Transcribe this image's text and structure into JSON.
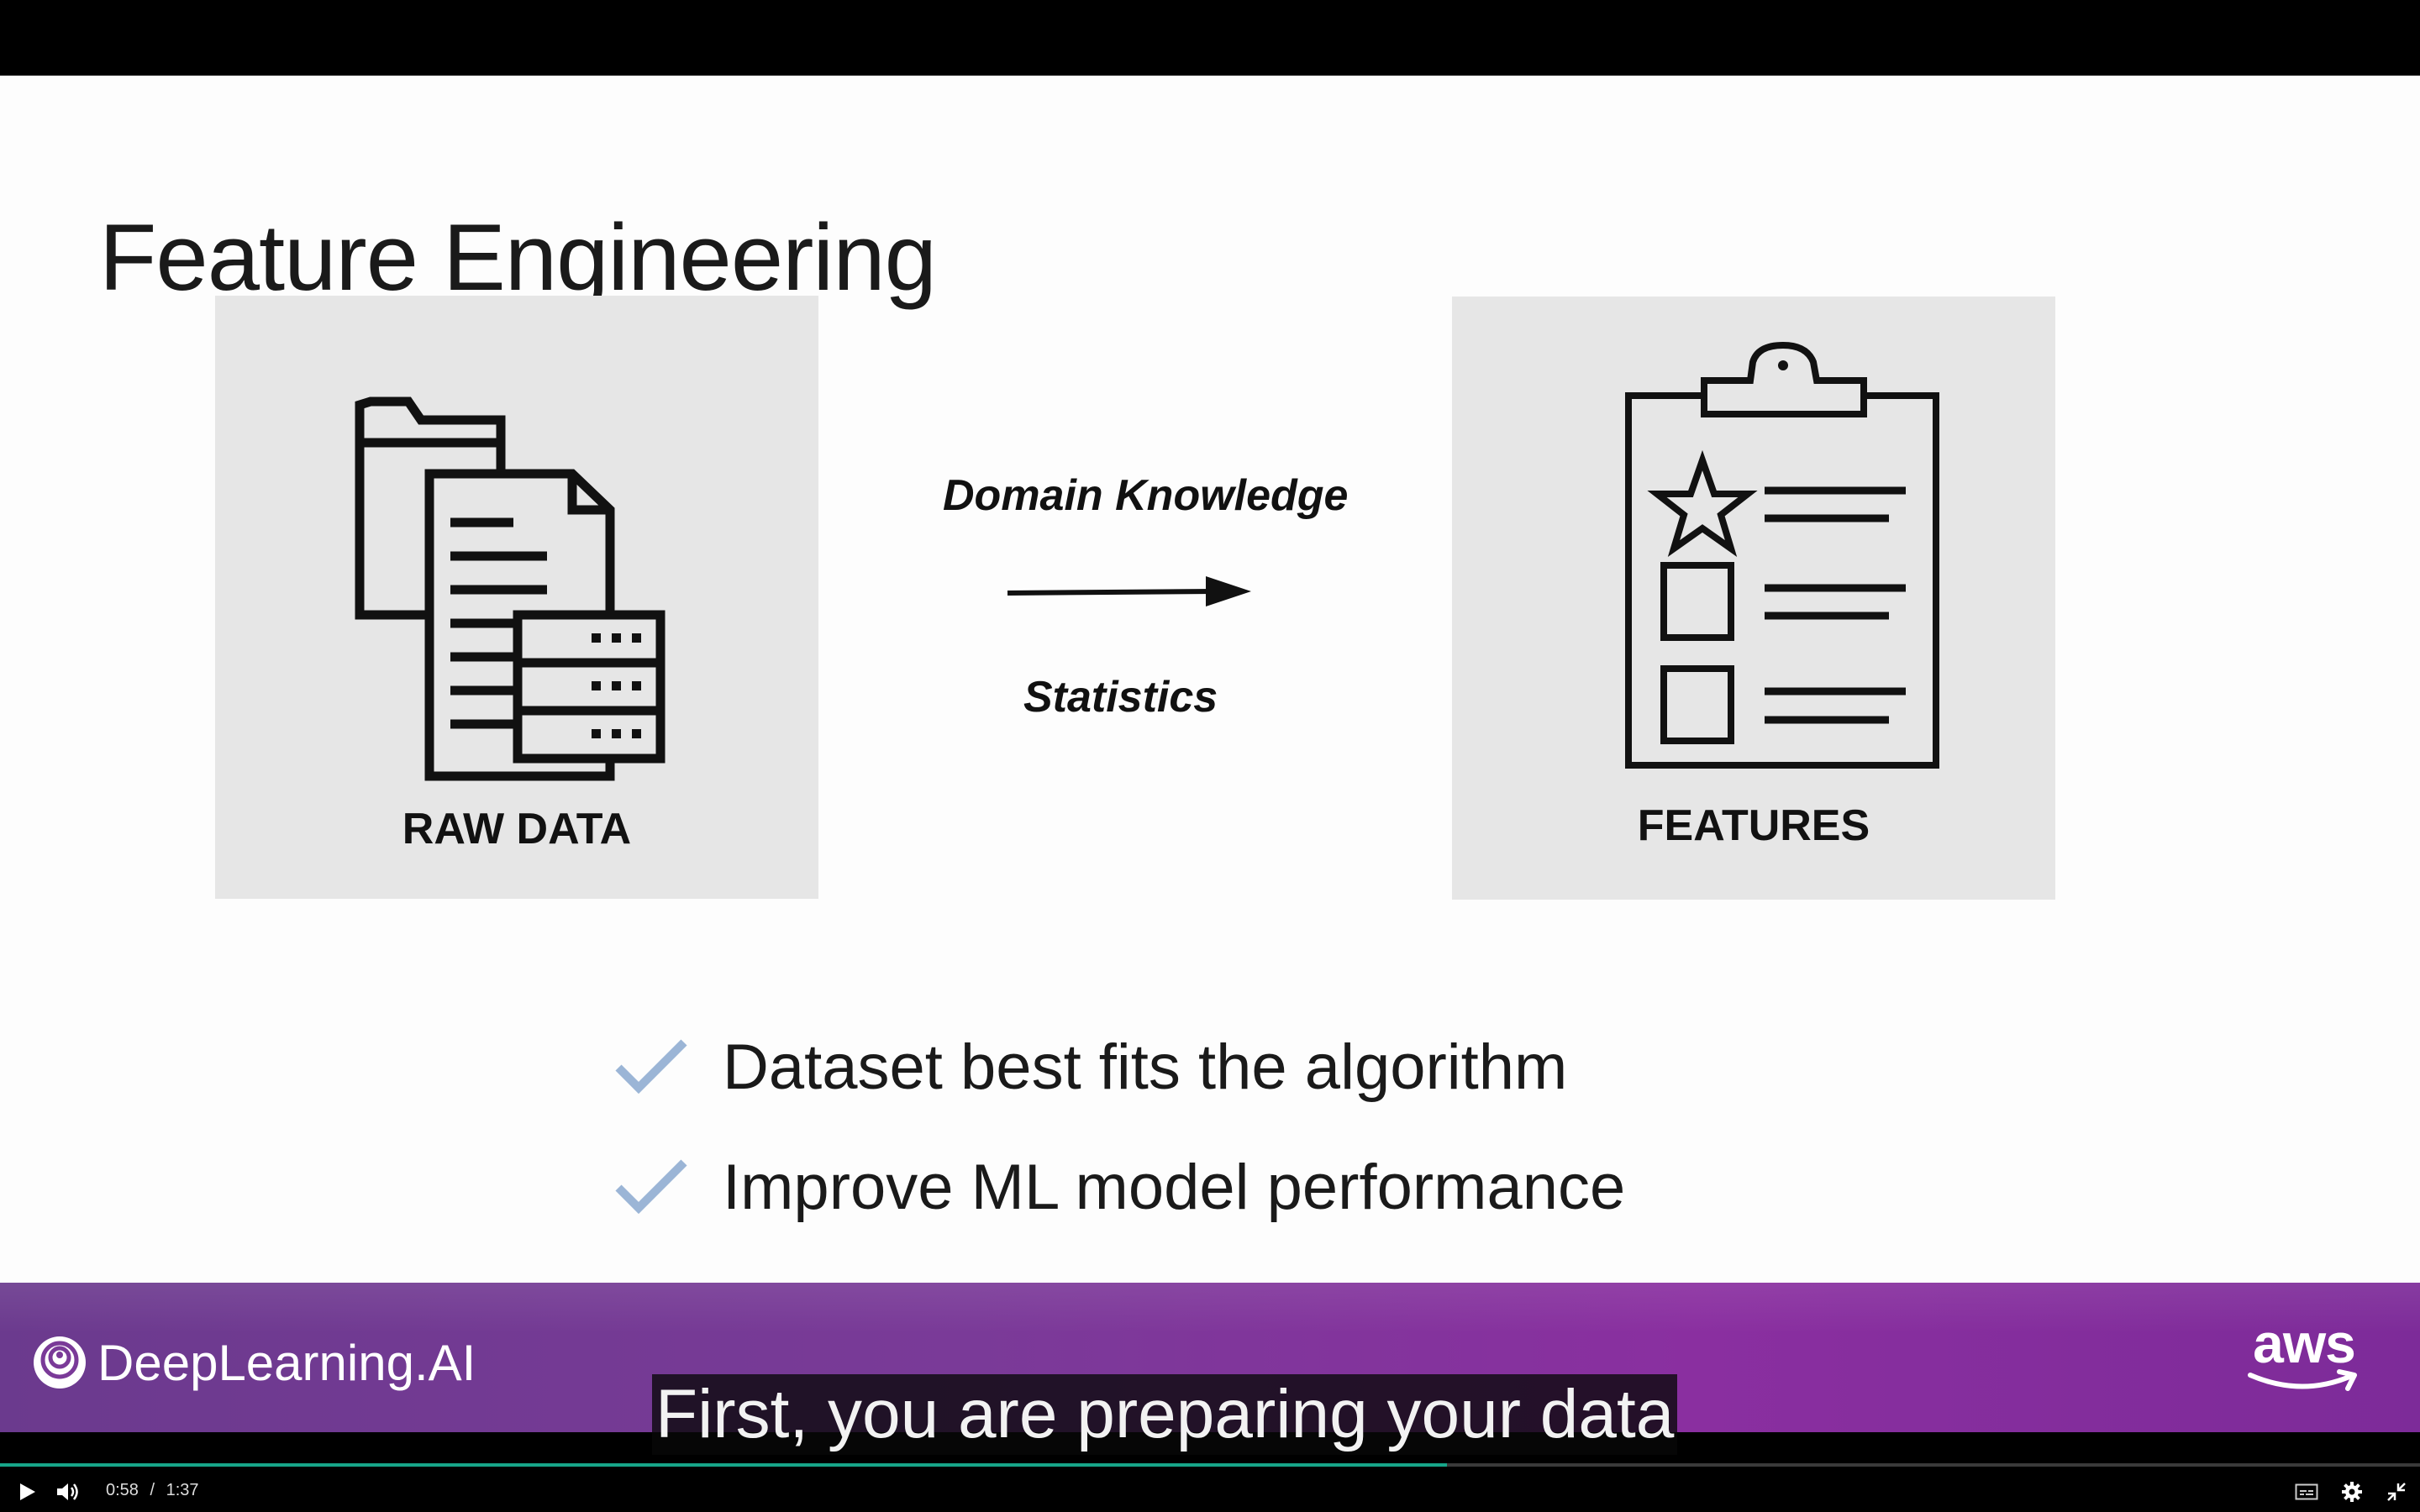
{
  "slide": {
    "title": "Feature Engineering",
    "raw_data_label": "RAW DATA",
    "features_label": "FEATURES",
    "arrow_top_label": "Domain Knowledge",
    "arrow_bottom_label": "Statistics",
    "bullets": [
      "Dataset best fits the algorithm",
      "Improve ML model performance"
    ]
  },
  "branding": {
    "left_logo": "DeepLearning.AI",
    "right_logo": "aws"
  },
  "caption": "First, you are preparing your data",
  "player": {
    "current_time": "0:58",
    "separator": "/",
    "duration": "1:37",
    "progress": 0.598,
    "accent_color": "#17a589",
    "icons": [
      "play-icon",
      "volume-icon",
      "closed-captions-icon",
      "gear-icon",
      "exit-fullscreen-icon"
    ]
  },
  "colors": {
    "check": "#9bb5d6",
    "brand_purple": "#7a3a98",
    "panel_bg": "#e6e6e6"
  }
}
